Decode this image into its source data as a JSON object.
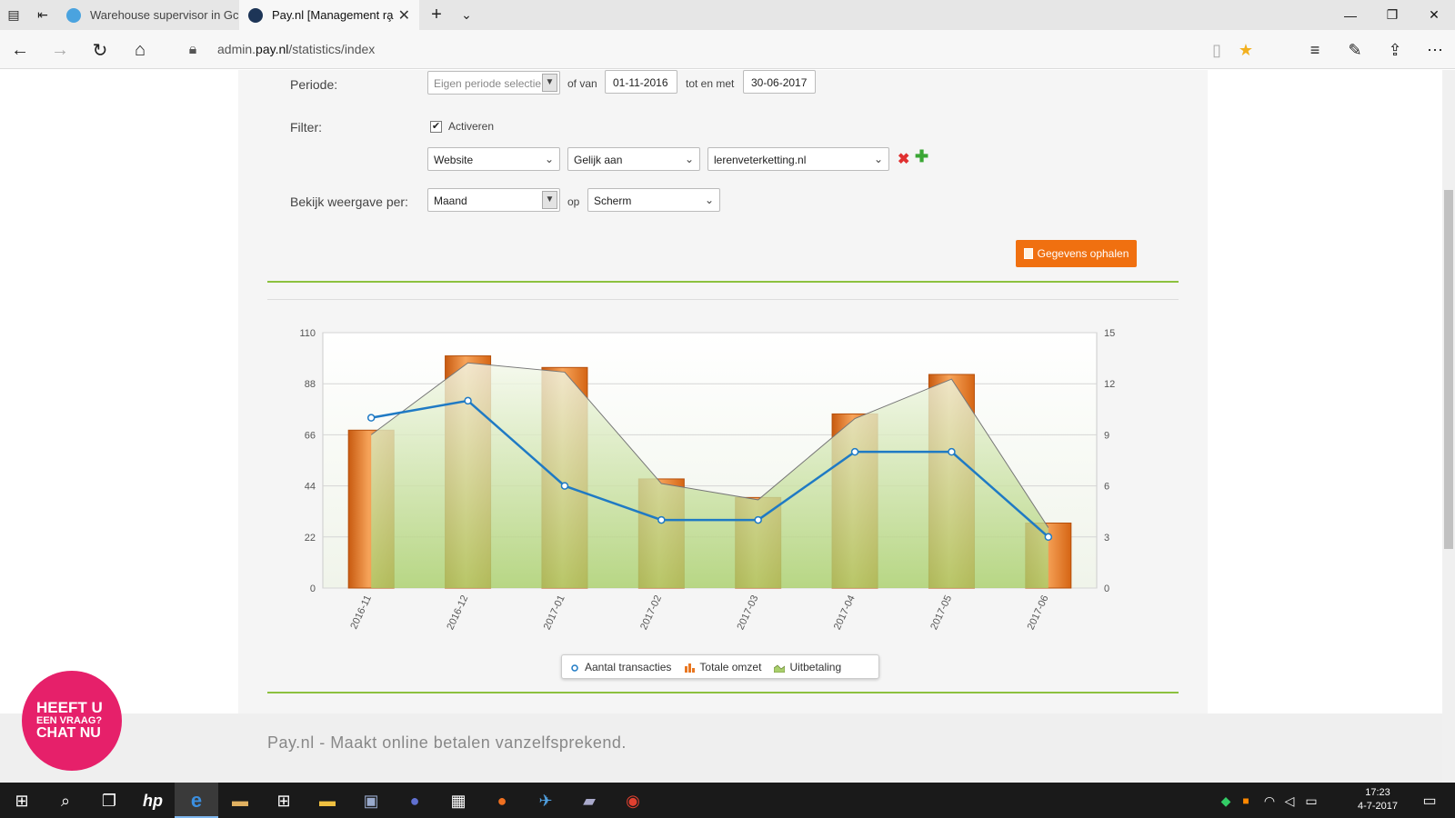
{
  "browser": {
    "tabs": [
      {
        "label": "Warehouse supervisor in Gc",
        "active": false,
        "favicon_color": "#4aa3df"
      },
      {
        "label": "Pay.nl [Management ra̧",
        "active": true,
        "favicon_color": "#1d3557"
      }
    ],
    "url_prefix": "admin.",
    "url_domain": "pay.nl",
    "url_path": "/statistics/index"
  },
  "form": {
    "period_label": "Periode:",
    "period_select": "Eigen periode selectie",
    "from_label": "of van",
    "from_date": "01-11-2016",
    "to_label": "tot en met",
    "to_date": "30-06-2017",
    "filter_label": "Filter:",
    "activate_label": "Activeren",
    "activate_checked": true,
    "filter_field": "Website",
    "filter_operator": "Gelijk aan",
    "filter_value": "lerenveterketting.nl",
    "view_label": "Bekijk weergave per:",
    "view_select": "Maand",
    "on_label": "op",
    "output_select": "Scherm",
    "fetch_button": "Gegevens ophalen"
  },
  "chart_data": {
    "type": "bar",
    "categories": [
      "2016-11",
      "2016-12",
      "2017-01",
      "2017-02",
      "2017-03",
      "2017-04",
      "2017-05",
      "2017-06"
    ],
    "series": [
      {
        "name": "Totale omzet",
        "type": "bar",
        "axis": "left",
        "values": [
          68,
          100,
          95,
          47,
          39,
          75,
          92,
          28
        ]
      },
      {
        "name": "Uitbetaling",
        "type": "area",
        "axis": "left",
        "values": [
          66,
          97,
          93,
          45,
          38,
          73,
          90,
          26
        ]
      },
      {
        "name": "Aantal transacties",
        "type": "line",
        "axis": "right",
        "values": [
          10,
          11,
          6,
          4,
          4,
          8,
          8,
          3
        ]
      }
    ],
    "left_axis": {
      "ticks": [
        0,
        22,
        44,
        66,
        88,
        110
      ],
      "range": [
        0,
        110
      ]
    },
    "right_axis": {
      "ticks": [
        0,
        3,
        6,
        9,
        12,
        15
      ],
      "range": [
        0,
        15
      ]
    },
    "legend": [
      "Aantal transacties",
      "Totale omzet",
      "Uitbetaling"
    ],
    "legend_position": "bottom-center",
    "grid": true,
    "colors": {
      "bar": "#e87722",
      "area": "#a9cf6b",
      "line": "#1f7ac4"
    }
  },
  "footer": {
    "tagline": "Pay.nl - Maakt online betalen vanzelfsprekend.",
    "chat_line1": "HEEFT U",
    "chat_line2": "EEN VRAAG?",
    "chat_line3": "CHAT NU"
  },
  "taskbar": {
    "time": "17:23",
    "date": "4-7-2017"
  }
}
